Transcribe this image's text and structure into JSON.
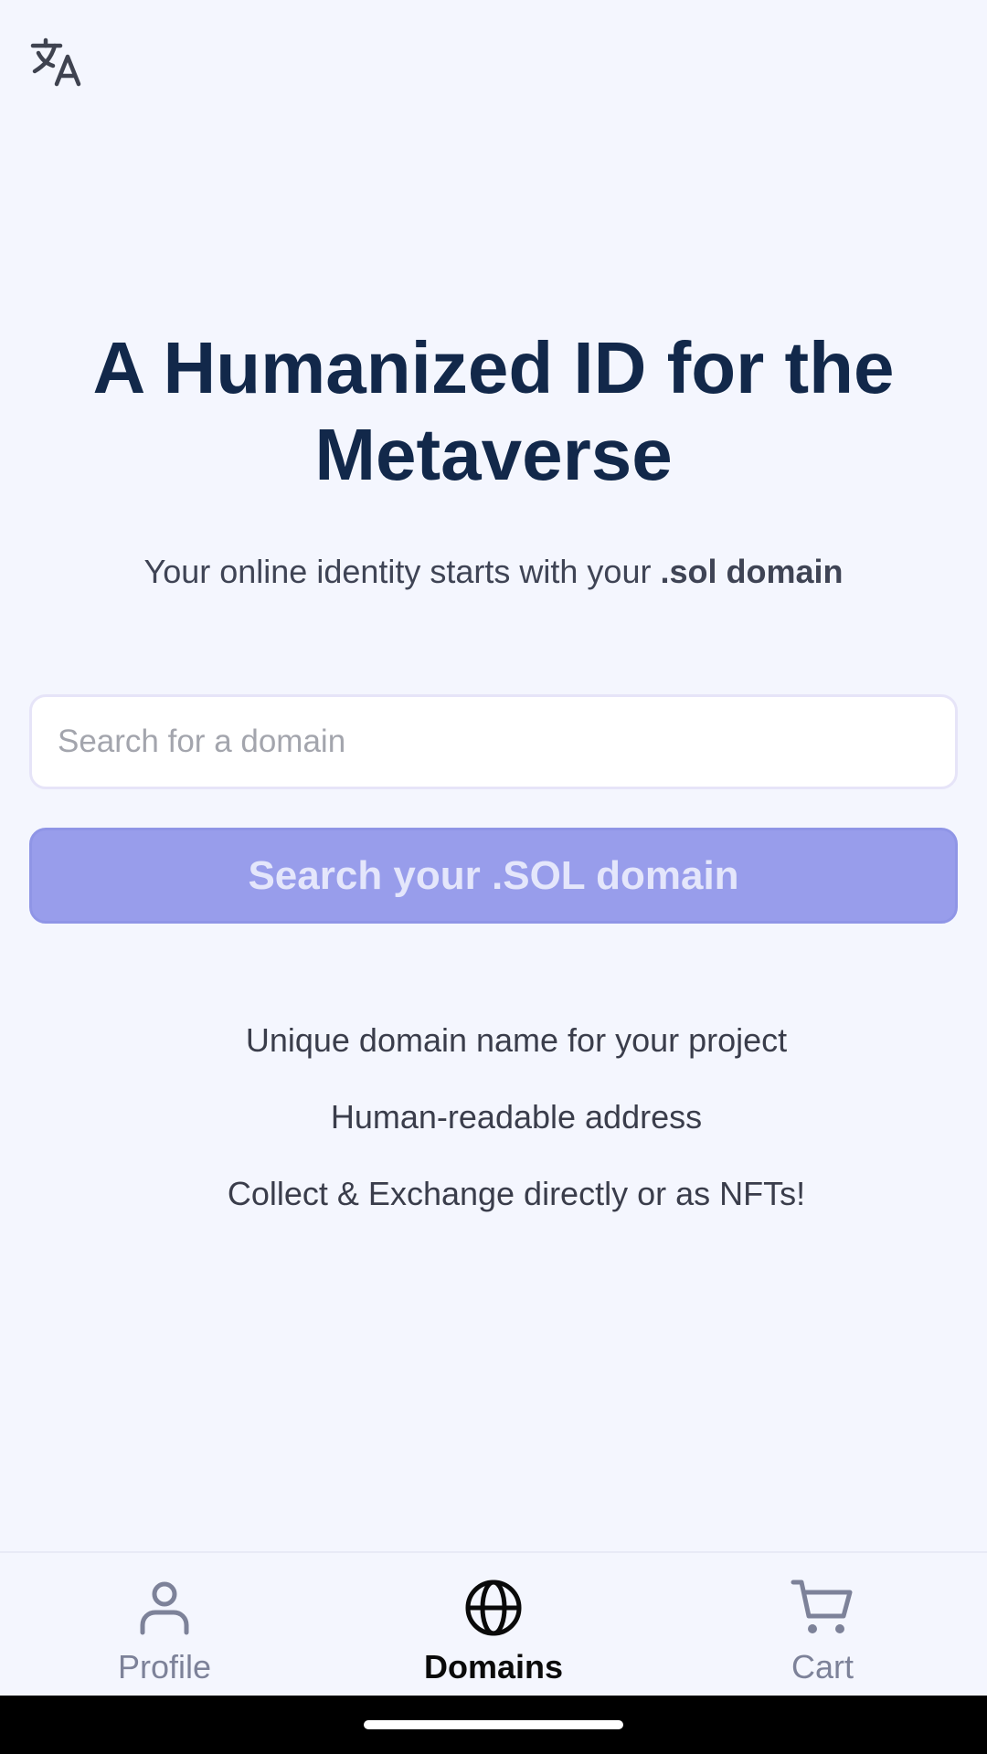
{
  "header": {
    "translate_icon": "translate-icon"
  },
  "hero": {
    "title": "A Humanized ID for the Metaverse",
    "subtitle_prefix": "Your online identity starts with your ",
    "subtitle_bold": ".sol domain"
  },
  "search": {
    "placeholder": "Search for a domain",
    "value": "",
    "button_label": "Search your .SOL domain"
  },
  "features": [
    "Unique domain name for your project",
    "Human-readable address",
    "Collect & Exchange directly or as NFTs!"
  ],
  "bottom_nav": {
    "items": [
      {
        "label": "Profile",
        "icon": "person-icon",
        "active": false
      },
      {
        "label": "Domains",
        "icon": "globe-icon",
        "active": true
      },
      {
        "label": "Cart",
        "icon": "cart-icon",
        "active": false
      }
    ]
  },
  "colors": {
    "background": "#f4f6fe",
    "title": "#12284a",
    "button_bg": "#989deb",
    "button_text": "#e4e6fb",
    "nav_inactive": "#7d8299",
    "nav_active": "#0a0a0a"
  }
}
